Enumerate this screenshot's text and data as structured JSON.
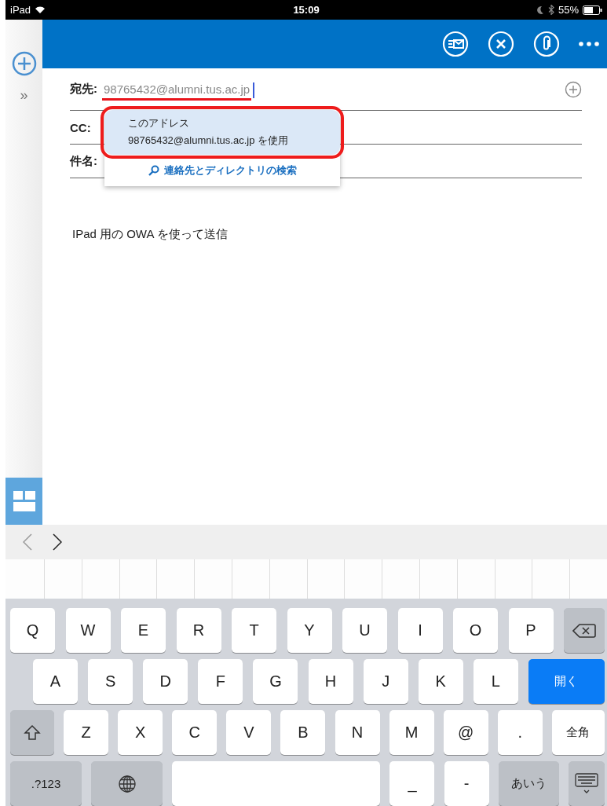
{
  "status_bar": {
    "device": "iPad",
    "time": "15:09",
    "battery": "55%"
  },
  "sidebar": {
    "expand": "»"
  },
  "compose": {
    "fields": [
      {
        "label": "宛先:",
        "value": "98765432@alumni.tus.ac.jp",
        "underlined": true,
        "focused": true
      },
      {
        "label": "CC:"
      },
      {
        "label": "件名:"
      }
    ],
    "suggestions": {
      "items": [
        {
          "lines": [
            "このアドレス",
            "98765432@alumni.tus.ac.jp を使用"
          ],
          "selected": true,
          "circled": true
        }
      ],
      "search_link": "連絡先とディレクトリの検索"
    },
    "body": "IPad 用の OWA を使って送信"
  },
  "keyboard": {
    "rows": [
      {
        "keys": [
          {
            "kind": "letter",
            "label": "Q"
          },
          {
            "kind": "letter",
            "label": "W"
          },
          {
            "kind": "letter",
            "label": "E"
          },
          {
            "kind": "letter",
            "label": "R"
          },
          {
            "kind": "letter",
            "label": "T"
          },
          {
            "kind": "letter",
            "label": "Y"
          },
          {
            "kind": "letter",
            "label": "U"
          },
          {
            "kind": "letter",
            "label": "I"
          },
          {
            "kind": "letter",
            "label": "O"
          },
          {
            "kind": "letter",
            "label": "P"
          },
          {
            "kind": "backspace"
          }
        ]
      },
      {
        "keys": [
          {
            "kind": "letter",
            "label": "A"
          },
          {
            "kind": "letter",
            "label": "S"
          },
          {
            "kind": "letter",
            "label": "D"
          },
          {
            "kind": "letter",
            "label": "F"
          },
          {
            "kind": "letter",
            "label": "G"
          },
          {
            "kind": "letter",
            "label": "H"
          },
          {
            "kind": "letter",
            "label": "J"
          },
          {
            "kind": "letter",
            "label": "K"
          },
          {
            "kind": "letter",
            "label": "L"
          },
          {
            "kind": "return",
            "label": "開く"
          }
        ]
      },
      {
        "keys": [
          {
            "kind": "shift"
          },
          {
            "kind": "letter",
            "label": "Z"
          },
          {
            "kind": "letter",
            "label": "X"
          },
          {
            "kind": "letter",
            "label": "C"
          },
          {
            "kind": "letter",
            "label": "V"
          },
          {
            "kind": "letter",
            "label": "B"
          },
          {
            "kind": "letter",
            "label": "N"
          },
          {
            "kind": "letter",
            "label": "M"
          },
          {
            "kind": "letter",
            "label": "@"
          },
          {
            "kind": "letter",
            "label": "."
          },
          {
            "kind": "wide",
            "label": "全角"
          }
        ]
      },
      {
        "keys": [
          {
            "kind": "mode",
            "label": ".?123"
          },
          {
            "kind": "globe"
          },
          {
            "kind": "space"
          },
          {
            "kind": "letter",
            "label": "_"
          },
          {
            "kind": "letter",
            "label": "-"
          },
          {
            "kind": "lang",
            "label": "あいう"
          },
          {
            "kind": "dismiss"
          }
        ]
      }
    ]
  }
}
